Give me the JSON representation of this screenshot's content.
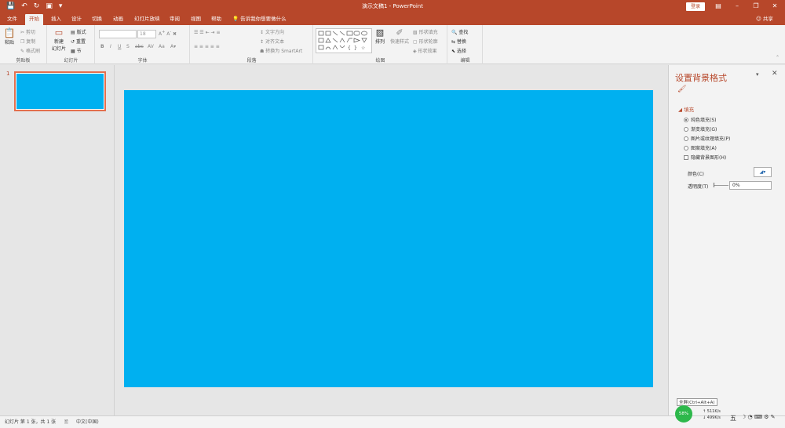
{
  "titlebar": {
    "title": "演示文稿1 - PowerPoint",
    "login": "登录",
    "qat": [
      "save-icon",
      "undo-icon",
      "redo-icon",
      "start-from-beginning-icon",
      "customize-icon"
    ]
  },
  "tabs": [
    {
      "label": "文件"
    },
    {
      "label": "开始"
    },
    {
      "label": "插入"
    },
    {
      "label": "设计"
    },
    {
      "label": "切换"
    },
    {
      "label": "动画"
    },
    {
      "label": "幻灯片放映"
    },
    {
      "label": "审阅"
    },
    {
      "label": "视图"
    },
    {
      "label": "帮助"
    }
  ],
  "tellme": "告诉我你想要做什么",
  "share": "共享",
  "ribbon": {
    "clipboard": {
      "label": "剪贴板",
      "paste": "粘贴",
      "cut": "剪切",
      "copy": "复制",
      "format_painter": "格式刷"
    },
    "slides": {
      "label": "幻灯片",
      "new_slide": "新建",
      "new_slide2": "幻灯片",
      "layout": "版式",
      "reset": "重置",
      "section": "节"
    },
    "font": {
      "label": "字体",
      "size": "18"
    },
    "paragraph": {
      "label": "段落",
      "text_direction": "文字方向",
      "align_text": "对齐文本",
      "smartart": "转换为 SmartArt"
    },
    "drawing": {
      "label": "绘图",
      "arrange": "排列",
      "quick_styles": "快速样式",
      "shape_fill": "形状填充",
      "shape_outline": "形状轮廓",
      "shape_effects": "形状效果"
    },
    "editing": {
      "label": "编辑",
      "find": "查找",
      "replace": "替换",
      "select": "选择"
    }
  },
  "thumbs": {
    "slide_number": "1"
  },
  "slide": {
    "background": "#00b0f0"
  },
  "panel": {
    "title": "设置背景格式",
    "fill_header": "填充",
    "options": [
      {
        "label": "纯色填充(S)",
        "selected": true
      },
      {
        "label": "渐变填充(G)",
        "selected": false
      },
      {
        "label": "图片或纹理填充(P)",
        "selected": false
      },
      {
        "label": "图案填充(A)",
        "selected": false
      }
    ],
    "hide_graphics": "隐藏背景图形(H)",
    "color_label": "颜色(C)",
    "transparency_label": "透明度(T)",
    "transparency_value": "0%"
  },
  "status": {
    "slide_info": "幻灯片 第 1 张，共 1 张",
    "language": "中文(中国)"
  },
  "tray": {
    "percent": "58%",
    "up": "511K/s",
    "down": "499K/s",
    "ime": "五",
    "tip": "全屏(Ctrl+Alt+A)"
  },
  "colors": {
    "accent": "#b7472a",
    "slide_fill": "#00b0f0"
  }
}
